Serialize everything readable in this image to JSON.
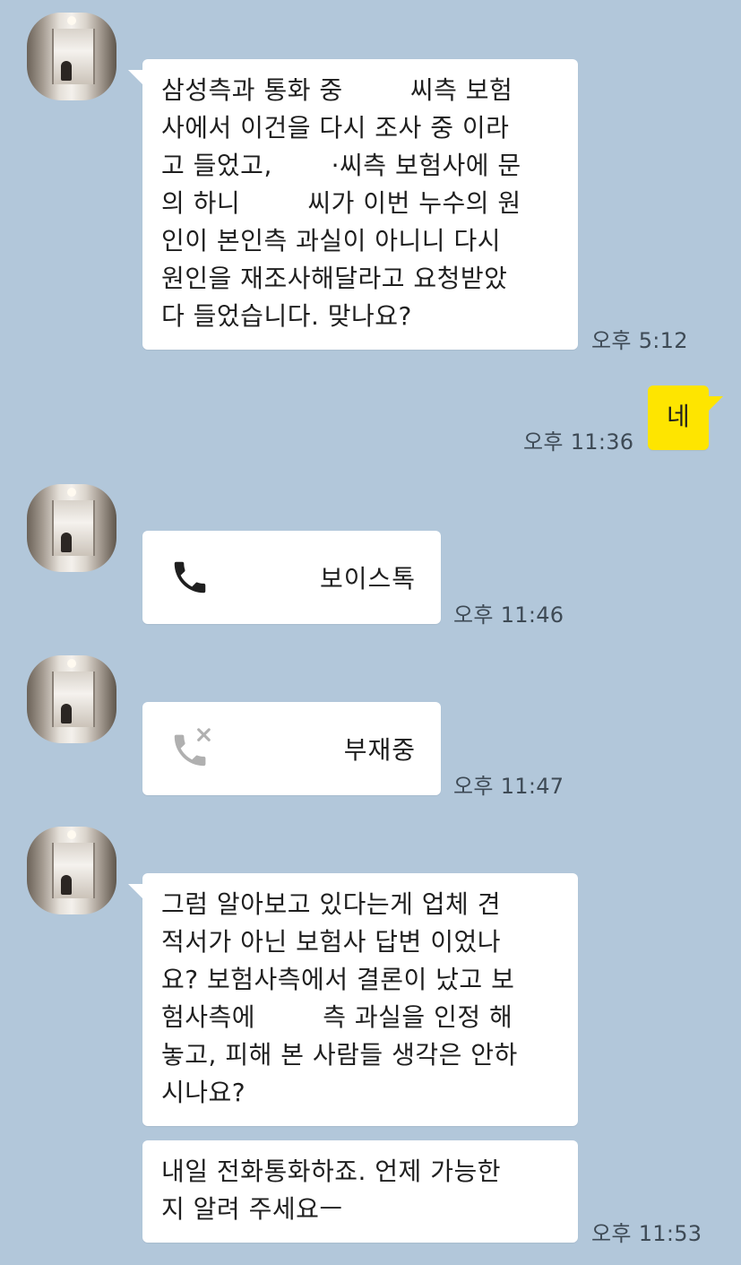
{
  "messages": [
    {
      "text": "삼성측과 통화 중        씨측 보험\n사에서 이건을 다시 조사 중 이라\n고 들었고,       ·씨측 보험사에 문\n의 하니        씨가 이번 누수의 원\n인이 본인측 과실이 아니니 다시\n원인을 재조사해달라고 요청받았\n다 들었습니다. 맞나요?",
      "time": "오후 5:12"
    },
    {
      "text": "네",
      "time": "오후 11:36"
    },
    {
      "label": "보이스톡",
      "icon": "phone-icon",
      "time": "오후 11:46"
    },
    {
      "label": "부재중",
      "icon": "missed-call-icon",
      "time": "오후 11:47"
    },
    {
      "text": "그럼 알아보고 있다는게 업체 견\n적서가 아닌 보험사 답변 이었나\n요? 보험사측에서 결론이 났고 보\n험사측에        측 과실을 인정 해\n놓고, 피해 본 사람들 생각은 안하\n시나요?"
    },
    {
      "text": "내일 전화통화하죠. 언제 가능한\n지 알려 주세요ㅡ",
      "time": "오후 11:53"
    }
  ],
  "colors": {
    "background": "#b2c7da",
    "incoming_bubble": "#ffffff",
    "outgoing_bubble": "#fee500",
    "missed_icon": "#b0b0b0",
    "phone_icon": "#1f1f1f"
  }
}
